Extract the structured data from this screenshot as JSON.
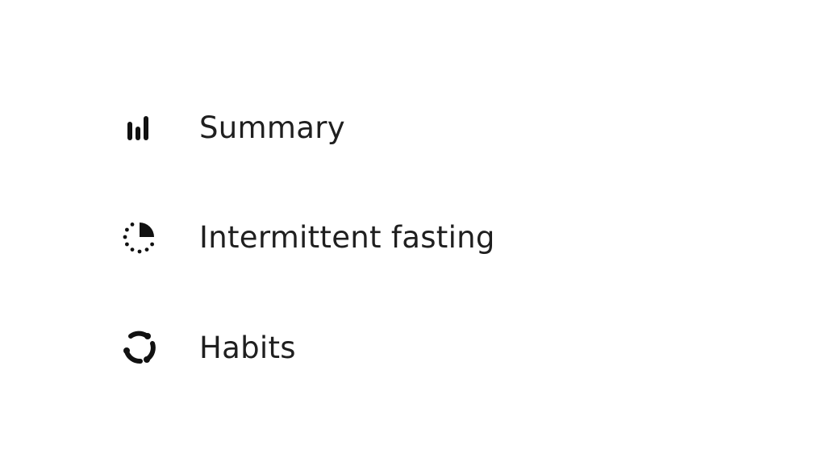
{
  "menu": {
    "items": [
      {
        "label": "Summary",
        "icon": "bar-chart-icon"
      },
      {
        "label": "Intermittent fasting",
        "icon": "fasting-timer-icon"
      },
      {
        "label": "Habits",
        "icon": "habits-cycle-icon"
      }
    ]
  },
  "colors": {
    "background": "#ffffff",
    "text": "#1f1f1f",
    "icon": "#111111"
  }
}
